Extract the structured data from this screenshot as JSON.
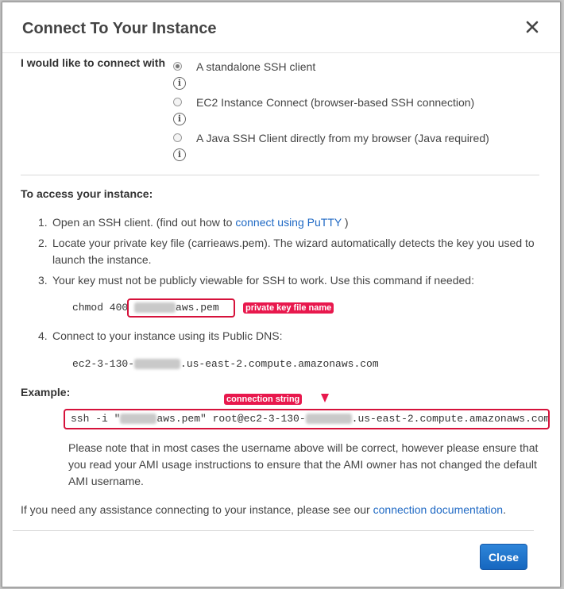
{
  "dialog": {
    "title": "Connect To Your Instance"
  },
  "connect_with": {
    "label": "I would like to connect with",
    "options": [
      {
        "label": "A standalone SSH client",
        "selected": true
      },
      {
        "label": "EC2 Instance Connect (browser-based SSH connection)",
        "selected": false
      },
      {
        "label": "A Java SSH Client directly from my browser (Java required)",
        "selected": false
      }
    ]
  },
  "access": {
    "title": "To access your instance:",
    "steps": [
      {
        "num": "1.",
        "pre": "Open an SSH client. (find out how to",
        "link": "connect using PuTTY",
        "post": ")"
      },
      {
        "num": "2.",
        "line1": "Locate your private key file (carrieaws.pem). The wizard automatically detects the key you used to",
        "line2": "launch the instance."
      },
      {
        "num": "3.",
        "text": "Your key must not be publicly viewable for SSH to work. Use this command if needed:"
      },
      {
        "num": "4.",
        "text": "Connect to your instance using its Public DNS:"
      }
    ],
    "chmod_prefix": "chmod 400 ",
    "chmod_suffix": "aws.pem",
    "dns_prefix": "ec2-3-130-",
    "dns_suffix": ".us-east-2.compute.amazonaws.com"
  },
  "annotations": {
    "key_file": "private key file name",
    "conn_string": "connection string",
    "color": "#e8184d"
  },
  "example": {
    "title": "Example:",
    "ssh_prefix": "ssh -i \"",
    "ssh_mid": "aws.pem\" root@ec2-3-130-",
    "ssh_suffix": ".us-east-2.compute.amazonaws.com",
    "note": "Please note that in most cases the username above will be correct, however please ensure that you read your AMI usage instructions to ensure that the AMI owner has not changed the default AMI username."
  },
  "assistance": {
    "pre": "If you need any assistance connecting to your instance, please see our",
    "link": "connection documentation",
    "post": "."
  },
  "footer": {
    "close_label": "Close",
    "accent": "#1f69c4"
  }
}
